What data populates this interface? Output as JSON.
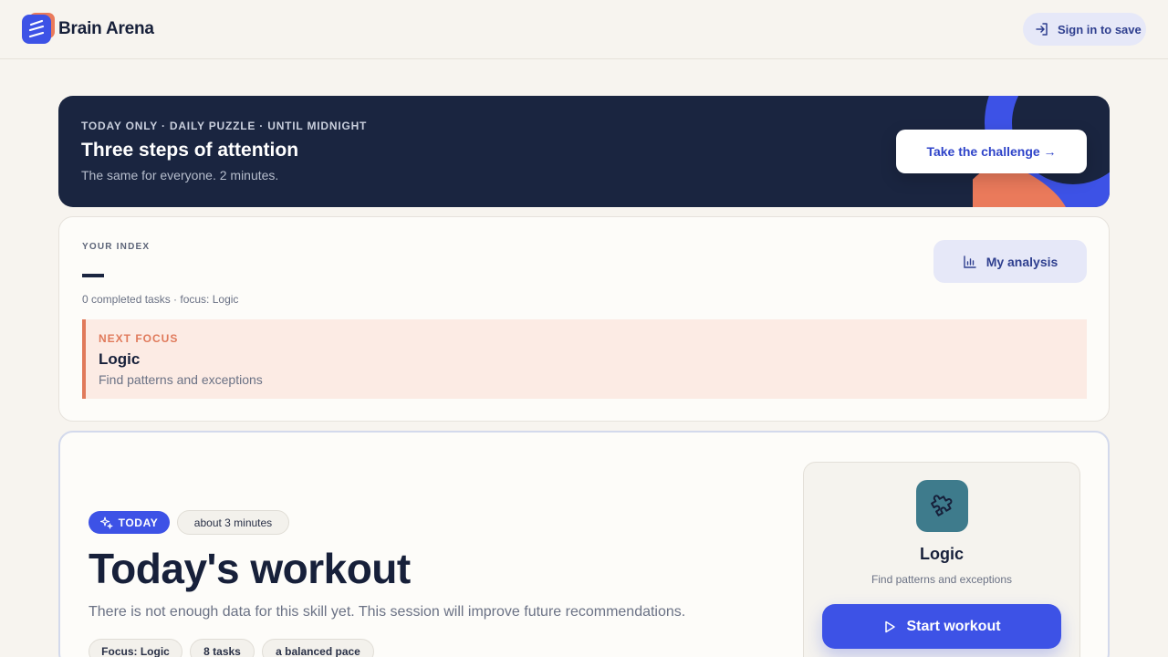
{
  "header": {
    "brand": "Brain Arena",
    "logo_icon": "menu-lines-icon",
    "signin_icon": "sign-in-icon",
    "signin_label": "Sign in to save"
  },
  "banner": {
    "eyebrow": "TODAY ONLY · DAILY PUZZLE · UNTIL MIDNIGHT",
    "title": "Three steps of attention",
    "subtitle": "The same for everyone. 2 minutes.",
    "cta_label": "Take the challenge →"
  },
  "index": {
    "eyebrow": "YOUR INDEX",
    "value": "—",
    "meta": "0 completed tasks · focus: Logic",
    "analysis_icon": "bar-chart-icon",
    "analysis_label": "My analysis",
    "next_focus": {
      "eyebrow": "NEXT FOCUS",
      "title": "Logic",
      "subtitle": "Find patterns and exceptions"
    }
  },
  "workout": {
    "badge_icon": "sparkles-icon",
    "badge_label": "TODAY",
    "duration": "about 3 minutes",
    "title": "Today's workout",
    "description": "There is not enough data for this skill yet. This session will improve future recommendations.",
    "tags": [
      "Focus: Logic",
      "8 tasks",
      "a balanced pace"
    ],
    "skill": {
      "icon": "puzzle-icon",
      "name": "Logic",
      "subtitle": "Find patterns and exceptions"
    },
    "start_icon": "play-icon",
    "start_label": "Start workout"
  },
  "colors": {
    "accent": "#3d52e6",
    "coral": "#e07a5b",
    "navy": "#1a2540",
    "background": "#f7f4ef"
  }
}
